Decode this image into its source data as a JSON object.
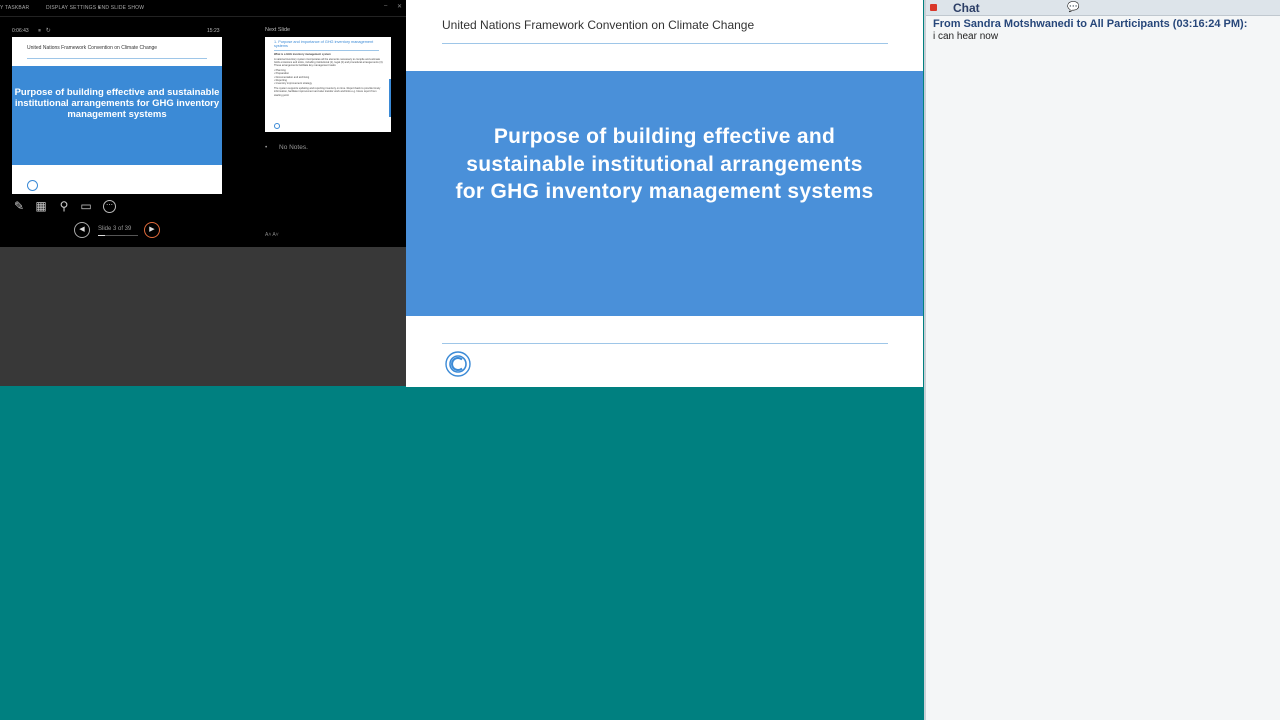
{
  "presenter": {
    "toolbar": {
      "taskbar": "Y TASKBAR",
      "display_settings": "DISPLAY SETTINGS ▾",
      "end_show": "END SLIDE SHOW",
      "min_icon": "minimize-icon",
      "close_icon": "close-icon"
    },
    "timer": "0:06:43",
    "clock": "15:23",
    "current_slide": {
      "header": "United Nations Framework Convention on Climate Change",
      "title": "Purpose of building effective and sustainable institutional arrangements for GHG inventory management systems"
    },
    "tools": [
      "pen-icon",
      "see-all-slides-icon",
      "zoom-icon",
      "screen-icon",
      "more-options-icon"
    ],
    "slide_counter": "Slide 3 of 39",
    "next_label": "Next Slide",
    "next_slide": {
      "title": "1. Purpose and importance of GHG inventory management systems",
      "heading": "What is a GHG inventory management system",
      "para1": "A national inventory system incorporates all the elements necessary to compile and estimate GHG emissions and sinks, including institutional (1), legal (2) and procedural arrangements (3). These arrangements facilitate key management tasks:",
      "bullets": [
        "Planning",
        "Preparation",
        "Documentation and archiving",
        "Reporting",
        "Inventory improvement strategy"
      ],
      "para2": "The system supports updating and reporting inventory on time. Report back to provide timely information, facilitate improvement and also transfer work and links e.g. future report from starting point"
    },
    "notes": "No Notes.",
    "font_btns": "A˄  A˅"
  },
  "slide": {
    "header": "United Nations Framework Convention on Climate Change",
    "title_lines": [
      "Purpose of building effective and",
      "sustainable institutional arrangements",
      "for GHG inventory management systems"
    ],
    "logo": "unfccc-logo"
  },
  "chat": {
    "title": "Chat",
    "messages": [
      {
        "from": "From Sandra Motshwanedi to All Participants (03:16:24 PM):",
        "text": "i can hear now"
      }
    ]
  },
  "colors": {
    "slide_blue": "#4a90d9",
    "teal_background": "#008080",
    "chat_background": "#f4f6f7"
  }
}
